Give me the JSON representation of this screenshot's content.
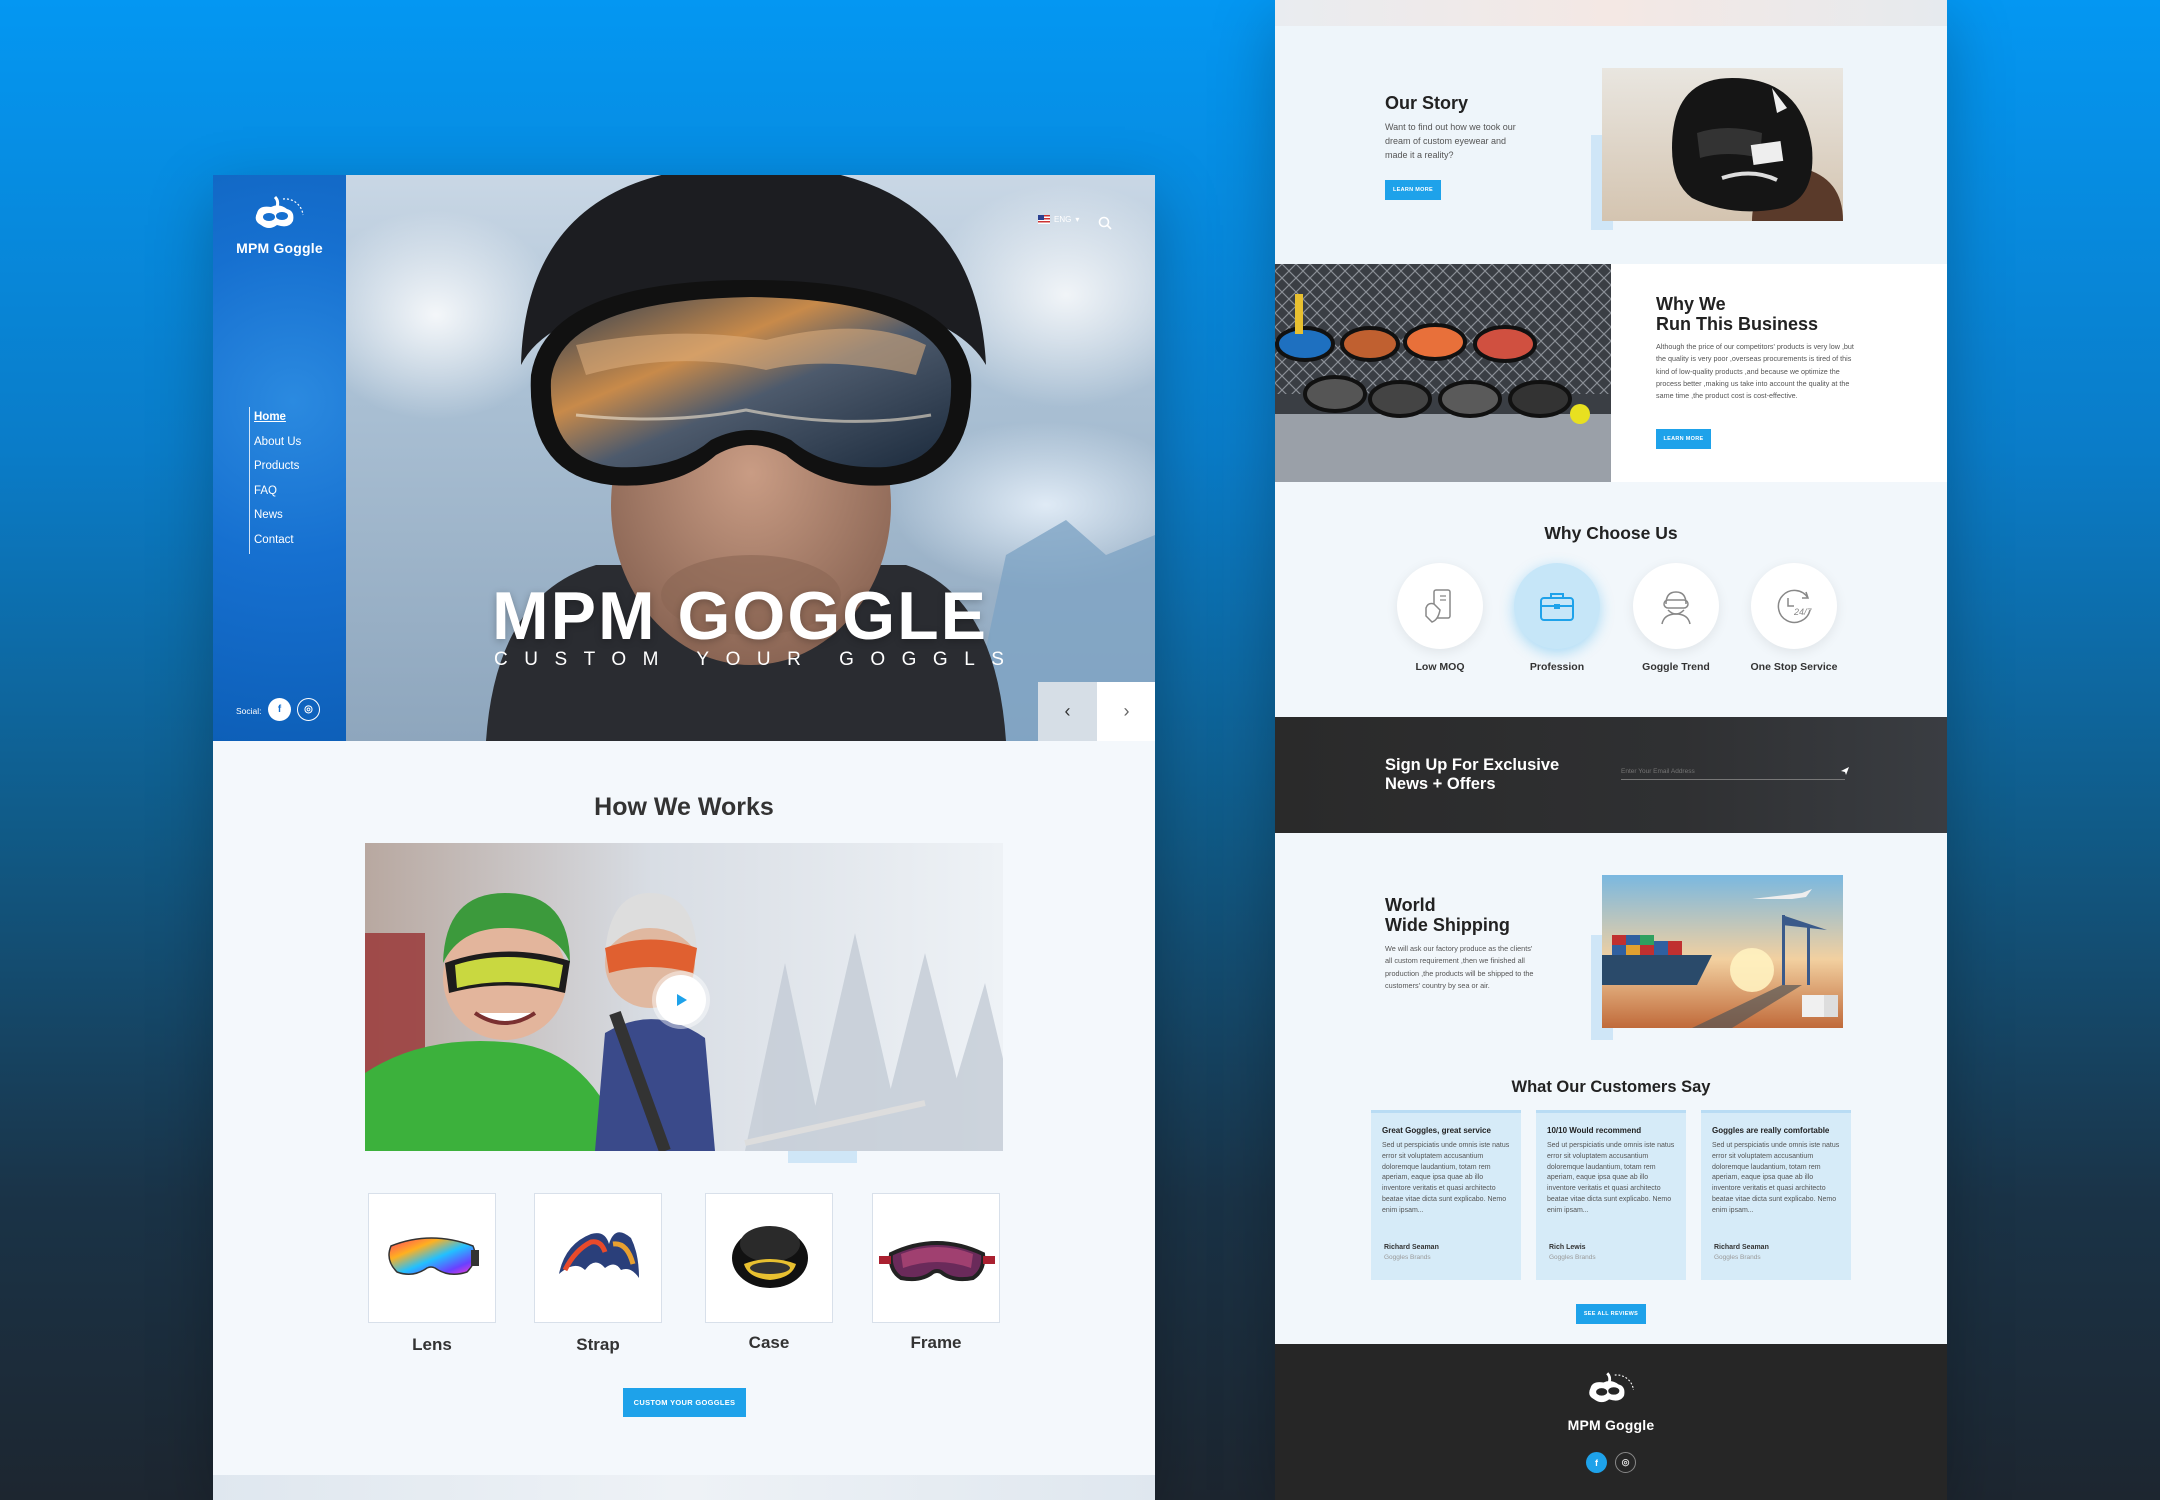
{
  "brand": {
    "name": "MPM Goggle",
    "footer_name": "MPM Goggle",
    "logo_ring_text": "CUSTOM YOUR GOGGLES"
  },
  "colors": {
    "accent": "#1ea2ea",
    "sidebar": "#1670d0",
    "dark": "#2a2a2a",
    "background": "#0497f2"
  },
  "sidebar": {
    "nav": [
      {
        "label": "Home",
        "active": true
      },
      {
        "label": "About Us"
      },
      {
        "label": "Products"
      },
      {
        "label": "FAQ"
      },
      {
        "label": "News"
      },
      {
        "label": "Contact"
      }
    ],
    "social_label": "Social:",
    "social": [
      {
        "icon": "facebook-icon",
        "glyph": "f"
      },
      {
        "icon": "instagram-icon",
        "glyph": "◎"
      }
    ]
  },
  "header": {
    "language": "ENG",
    "language_icon": "us-flag-icon",
    "search_icon": "search-icon"
  },
  "hero": {
    "title": "MPM GOGGLE",
    "subtitle": "CUSTOM YOUR GOGGLS",
    "prev_icon": "chevron-left-icon",
    "next_icon": "chevron-right-icon"
  },
  "how": {
    "title": "How We Works",
    "play_icon": "play-icon",
    "parts": [
      {
        "label": "Lens"
      },
      {
        "label": "Strap"
      },
      {
        "label": "Case"
      },
      {
        "label": "Frame"
      }
    ],
    "cta": "CUSTOM YOUR GOGGLES"
  },
  "story": {
    "title": "Our Story",
    "body": "Want to find out how we took our dream of custom eyewear and made it a reality?",
    "button": "LEARN MORE"
  },
  "business": {
    "title_line1": "Why We",
    "title_line2": "Run This Business",
    "body": "Although the price of our competitors' products is very low ,but the quality is very poor ,overseas procurements is tired of this kind of low-quality products ,and because we optimize the process better ,making us take into account the quality at the same time ,the product cost is cost-effective.",
    "button": "LEARN MORE"
  },
  "why_choose": {
    "title": "Why Choose Us",
    "items": [
      {
        "label": "Low MOQ",
        "icon": "hand-phone-icon"
      },
      {
        "label": "Profession",
        "icon": "briefcase-icon",
        "highlighted": true
      },
      {
        "label": "Goggle Trend",
        "icon": "goggle-person-icon"
      },
      {
        "label": "One Stop Service",
        "icon": "clock-24-7-icon",
        "icon_text": "24/7"
      }
    ]
  },
  "newsletter": {
    "title_line1": "Sign Up For Exclusive",
    "title_line2": "News + Offers",
    "placeholder": "Enter Your Email Address",
    "send_icon": "send-icon"
  },
  "shipping": {
    "title_line1": "World",
    "title_line2": "Wide Shipping",
    "body": "We will ask our factory produce as the clients' all custom requirement ,then we finished all production ,the products will be shipped to the customers' country by sea or air."
  },
  "reviews": {
    "title": "What Our Customers Say",
    "items": [
      {
        "title": "Great Goggles, great service",
        "body": "Sed ut perspiciatis unde omnis iste natus error sit voluptatem accusantium doloremque laudantium, totam rem aperiam, eaque ipsa quae ab illo inventore veritatis et quasi architecto beatae vitae dicta sunt explicabo. Nemo enim ipsam...",
        "name": "Richard Seaman",
        "brand": "Goggles Brands"
      },
      {
        "title": "10/10 Would recommend",
        "body": "Sed ut perspiciatis unde omnis iste natus error sit voluptatem accusantium doloremque laudantium, totam rem aperiam, eaque ipsa quae ab illo inventore veritatis et quasi architecto beatae vitae dicta sunt explicabo. Nemo enim ipsam...",
        "name": "Rich Lewis",
        "brand": "Goggles Brands"
      },
      {
        "title": "Goggles are really comfortable",
        "body": "Sed ut perspiciatis unde omnis iste natus error sit voluptatem accusantium doloremque laudantium, totam rem aperiam, eaque ipsa quae ab illo inventore veritatis et quasi architecto beatae vitae dicta sunt explicabo. Nemo enim ipsam...",
        "name": "Richard Seaman",
        "brand": "Goggles Brands"
      }
    ],
    "button": "SEE ALL REVIEWS"
  }
}
